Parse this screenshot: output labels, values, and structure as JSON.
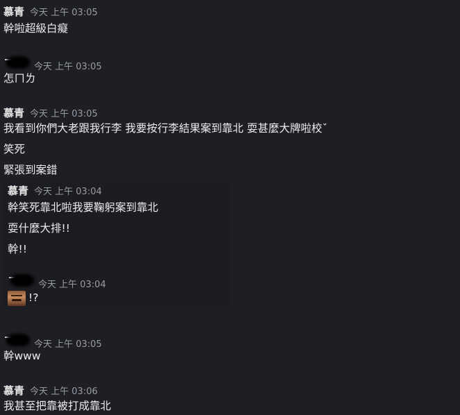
{
  "messages": [
    {
      "author": "慕青",
      "time": "今天 上午 03:05",
      "lines": [
        "幹啦超級白癡"
      ]
    },
    {
      "author": "",
      "time": "今天 上午 03:05",
      "lines": [
        "怎ㄇㄌ"
      ]
    },
    {
      "author": "慕青",
      "time": "今天 上午 03:05",
      "lines": [
        "我看到你們大老跟我行李 我要按行李結果案到靠北 耍甚麼大牌啦校ˇ",
        "笑死",
        "緊張到案錯"
      ]
    },
    {
      "author": "",
      "time": "今天 上午 03:05",
      "lines": [
        "幹www"
      ]
    },
    {
      "author": "慕青",
      "time": "今天 上午 03:06",
      "lines": [
        "我甚至把靠被打成靠北"
      ]
    }
  ],
  "quoted": [
    {
      "author": "慕青",
      "time": "今天 上午 03:04",
      "lines": [
        "幹笑死靠北啦我要鞠躬案到靠北",
        "耍什麼大排!!",
        "幹!!"
      ]
    },
    {
      "author": "",
      "time": "今天 上午 03:04",
      "lines": [
        "!?"
      ],
      "avatar_icon": "face-emoji-icon"
    }
  ]
}
